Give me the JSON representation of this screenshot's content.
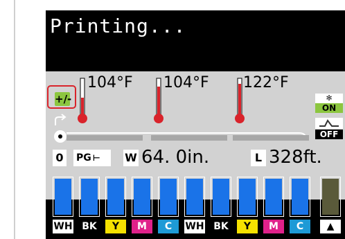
{
  "panel": {
    "status": "Printing...",
    "adjust_icon": "+/-",
    "temperatures": [
      {
        "label": "104°F",
        "level": 0.55
      },
      {
        "label": "104°F",
        "level": 0.55
      },
      {
        "label": "122°F",
        "level": 0.75
      }
    ],
    "fan": {
      "icon": "fan-icon",
      "state": "ON"
    },
    "heater": {
      "icon": "heater-icon",
      "state": "OFF"
    },
    "info": {
      "ink_count": "0",
      "pg_label": "PG",
      "width_icon": "W",
      "width_value": "64. 0in.",
      "length_icon": "L",
      "length_value": "328ft."
    },
    "inks": [
      {
        "label": "WH",
        "label_bg": "#ffffff",
        "label_fg": "#000000",
        "level": 1.0
      },
      {
        "label": "BK",
        "label_bg": "#000000",
        "label_fg": "#ffffff",
        "level": 1.0
      },
      {
        "label": "Y",
        "label_bg": "#f5e100",
        "label_fg": "#000000",
        "level": 1.0
      },
      {
        "label": "M",
        "label_bg": "#e0218a",
        "label_fg": "#ffffff",
        "level": 1.0
      },
      {
        "label": "C",
        "label_bg": "#1e9ad6",
        "label_fg": "#ffffff",
        "level": 1.0
      },
      {
        "label": "WH",
        "label_bg": "#ffffff",
        "label_fg": "#000000",
        "level": 1.0
      },
      {
        "label": "BK",
        "label_bg": "#000000",
        "label_fg": "#ffffff",
        "level": 1.0
      },
      {
        "label": "Y",
        "label_bg": "#f5e100",
        "label_fg": "#000000",
        "level": 1.0
      },
      {
        "label": "M",
        "label_bg": "#e0218a",
        "label_fg": "#ffffff",
        "level": 1.0
      },
      {
        "label": "C",
        "label_bg": "#1e9ad6",
        "label_fg": "#ffffff",
        "level": 1.0
      }
    ],
    "maintenance_box": {
      "icon": "drop-icon",
      "level": 1.0
    }
  }
}
